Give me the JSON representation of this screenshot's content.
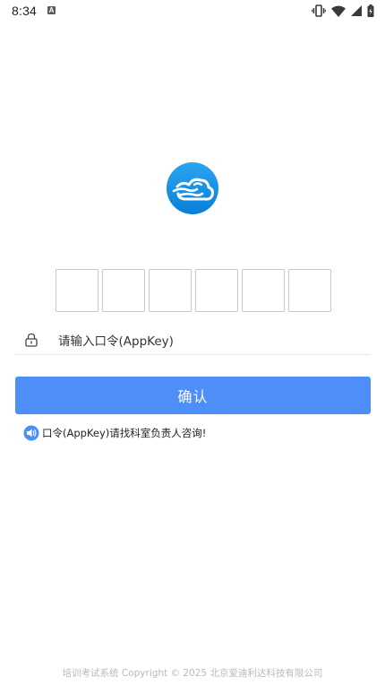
{
  "status_bar": {
    "time": "8:34",
    "notification_icon": "a-icon",
    "icons": [
      "vibrate-icon",
      "wifi-icon",
      "signal-icon",
      "battery-icon"
    ]
  },
  "logo": {
    "icon": "cloud-logo-icon",
    "color": "#1a8fe3"
  },
  "code_boxes": [
    "",
    "",
    "",
    "",
    "",
    ""
  ],
  "password_field": {
    "icon": "lock-icon",
    "placeholder": "请输入口令(AppKey)",
    "value": ""
  },
  "confirm_button": {
    "label": "确认",
    "color": "#4d8ef8"
  },
  "hint": {
    "icon": "speaker-icon",
    "text": "口令(AppKey)请找科室负责人咨询!"
  },
  "footer": {
    "text": "培训考试系统 Copyright © 2025 北京爱迪利达科技有限公司"
  }
}
